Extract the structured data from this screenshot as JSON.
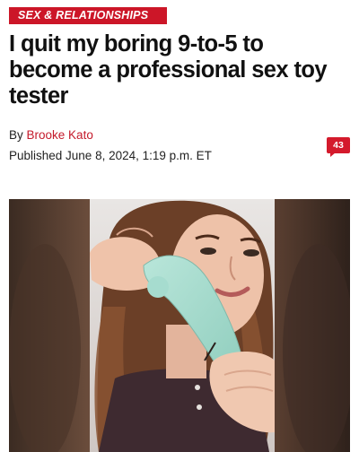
{
  "article": {
    "section": "SEX & RELATIONSHIPS",
    "headline": "I quit my boring 9-to-5 to become a professional sex toy tester",
    "byline_prefix": "By",
    "author": "Brooke Kato",
    "published": "Published June 8, 2024, 1:19 p.m. ET",
    "comment_count": "43"
  },
  "colors": {
    "brand_red": "#cc1628",
    "author_link": "#c41a2b",
    "text": "#111111"
  },
  "media": {
    "type": "video-still",
    "icon": "comment-bubble-icon"
  }
}
